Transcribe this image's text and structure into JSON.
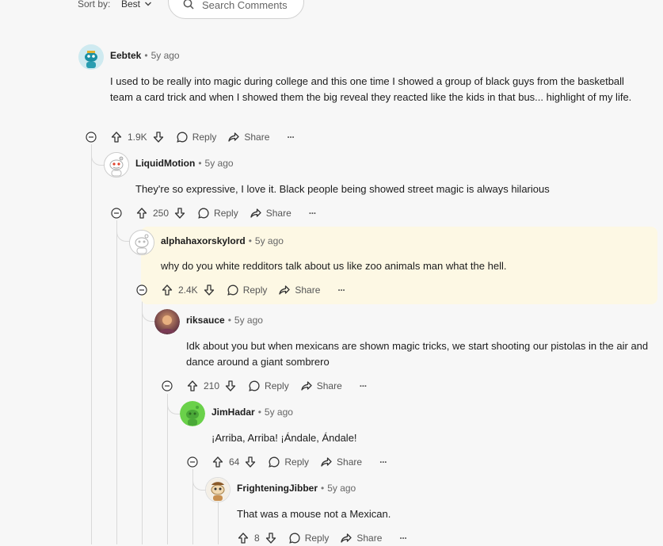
{
  "toolbar": {
    "sort_label": "Sort by:",
    "sort_value": "Best",
    "search_placeholder": "Search Comments"
  },
  "colors": {
    "highlight": "#fdf8e4",
    "thread_line": "#d9d9d9",
    "text": "#1c1c1c",
    "meta": "#666666"
  },
  "comments": [
    {
      "user": "Eebtek",
      "sep": "•",
      "time": "5y ago",
      "text": "I used to be really into magic during college and this one time I showed a group of black guys from the basketball team a card trick and when I showed them the big reveal they reacted like the kids in that bus... highlight of my life.",
      "votes": "1.9K",
      "reply": "Reply",
      "share": "Share",
      "more": "···"
    },
    {
      "user": "LiquidMotion",
      "sep": "•",
      "time": "5y ago",
      "text": "They're so expressive, I love it. Black people being showed street magic is always hilarious",
      "votes": "250",
      "reply": "Reply",
      "share": "Share",
      "more": "···"
    },
    {
      "user": "alphahaxorskylord",
      "sep": "•",
      "time": "5y ago",
      "text": "why do you white redditors talk about us like zoo animals man what the hell.",
      "votes": "2.4K",
      "reply": "Reply",
      "share": "Share",
      "more": "···",
      "highlighted": true
    },
    {
      "user": "riksauce",
      "sep": "•",
      "time": "5y ago",
      "text": "Idk about you but when mexicans are shown magic tricks, we start shooting our pistolas in the air and dance around a giant sombrero",
      "votes": "210",
      "reply": "Reply",
      "share": "Share",
      "more": "···"
    },
    {
      "user": "JimHadar",
      "sep": "•",
      "time": "5y ago",
      "text": "¡Arriba, Arriba! ¡Ándale, Ándale!",
      "votes": "64",
      "reply": "Reply",
      "share": "Share",
      "more": "···"
    },
    {
      "user": "FrighteningJibber",
      "sep": "•",
      "time": "5y ago",
      "text": "That was a mouse not a Mexican.",
      "votes": "8",
      "reply": "Reply",
      "share": "Share",
      "more": "···"
    }
  ]
}
